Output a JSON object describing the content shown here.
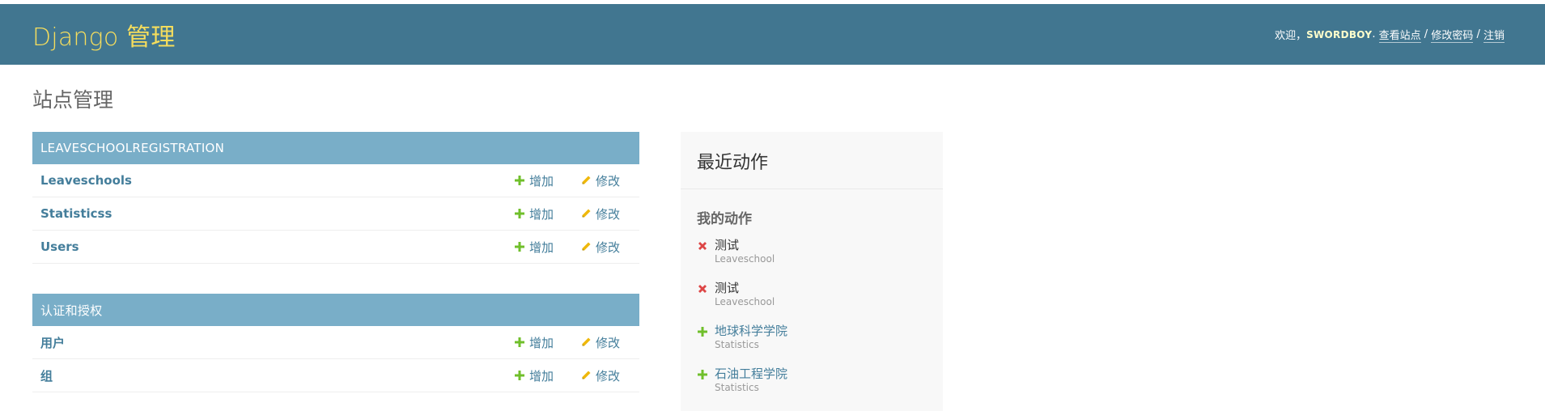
{
  "header": {
    "brand": "Django 管理",
    "welcome": "欢迎，",
    "username": "SWORDBOY",
    "sep_after_user": ". ",
    "view_site": "查看站点",
    "sep": " / ",
    "change_password": "修改密码",
    "logout": "注销"
  },
  "page": {
    "title": "站点管理"
  },
  "apps": [
    {
      "caption": "LEAVESCHOOLREGISTRATION",
      "models": [
        {
          "name": "Leaveschools",
          "add": "增加",
          "change": "修改"
        },
        {
          "name": "Statisticss",
          "add": "增加",
          "change": "修改"
        },
        {
          "name": "Users",
          "add": "增加",
          "change": "修改"
        }
      ]
    },
    {
      "caption": "认证和授权",
      "models": [
        {
          "name": "用户",
          "add": "增加",
          "change": "修改"
        },
        {
          "name": "组",
          "add": "增加",
          "change": "修改"
        }
      ]
    }
  ],
  "recent_actions": {
    "title": "最近动作",
    "subtitle": "我的动作",
    "items": [
      {
        "action": "delete",
        "text": "测试",
        "type": "Leaveschool"
      },
      {
        "action": "delete",
        "text": "测试",
        "type": "Leaveschool"
      },
      {
        "action": "add",
        "text": "地球科学学院",
        "type": "Statistics"
      },
      {
        "action": "add",
        "text": "石油工程学院",
        "type": "Statistics"
      }
    ]
  },
  "colors": {
    "header_bg": "#417690",
    "brand": "#f5dd5d",
    "caption_bg": "#79aec8",
    "link": "#447e9b",
    "add_icon": "#70bf2b",
    "change_icon": "#efb80b",
    "delete_icon": "#dd4646"
  },
  "icons": {
    "add": "plus-icon",
    "change": "pencil-icon",
    "delete": "x-icon"
  }
}
